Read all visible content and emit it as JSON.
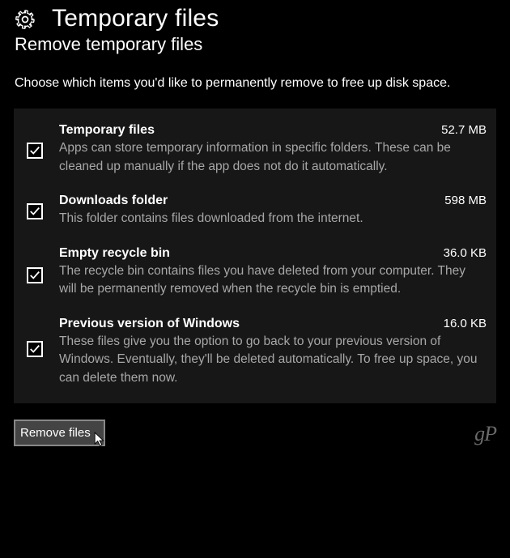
{
  "header": {
    "title": "Temporary files",
    "subtitle": "Remove temporary files"
  },
  "intro": "Choose which items you'd like to permanently remove to free up disk space.",
  "items": [
    {
      "title": "Temporary files",
      "size": "52.7 MB",
      "desc": "Apps can store temporary information in specific folders. These can be cleaned up manually if the app does not do it automatically.",
      "checked": true
    },
    {
      "title": "Downloads folder",
      "size": "598 MB",
      "desc": "This folder contains files downloaded from the internet.",
      "checked": true
    },
    {
      "title": "Empty recycle bin",
      "size": "36.0 KB",
      "desc": "The recycle bin contains files you have deleted from your computer. They will be permanently removed when the recycle bin is emptied.",
      "checked": true
    },
    {
      "title": "Previous version of Windows",
      "size": "16.0 KB",
      "desc": "These files give you the option to go back to your previous version of Windows. Eventually, they'll be deleted automatically. To free up space, you can delete them now.",
      "checked": true
    }
  ],
  "remove_button": "Remove files",
  "watermark": "gP"
}
